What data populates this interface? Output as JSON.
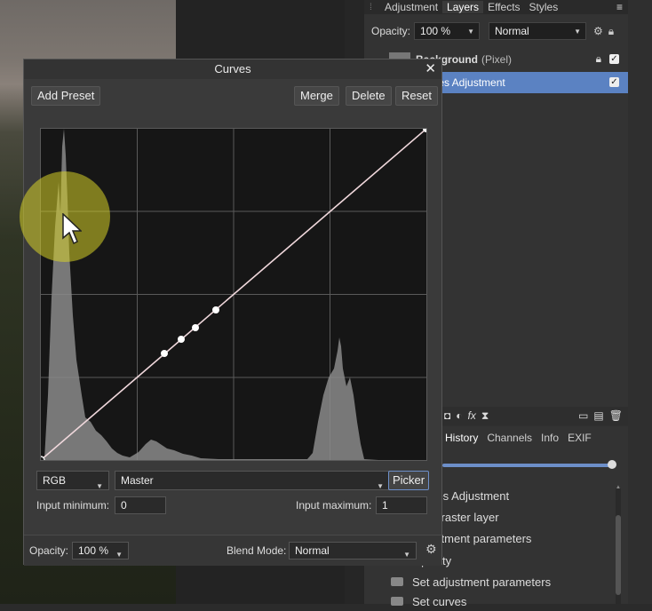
{
  "layers_panel": {
    "tabs": [
      "Adjustment",
      "Layers",
      "Effects",
      "Styles"
    ],
    "active_tab": "Layers",
    "opacity_label": "Opacity:",
    "opacity_value": "100 %",
    "blend_mode": "Normal",
    "layers": [
      {
        "name": "Background",
        "type": "(Pixel)",
        "selected": false
      },
      {
        "name": "Curves Adjustment",
        "selected": true
      }
    ]
  },
  "history_panel": {
    "tabs": [
      "History",
      "Channels",
      "Info",
      "EXIF"
    ],
    "active_tab": "History",
    "items": [
      "Curves Adjustment",
      "Pass raster layer",
      "Adjustment parameters",
      "Opacity",
      "Set adjustment parameters",
      "Set curves"
    ]
  },
  "curves_dialog": {
    "title": "Curves",
    "add_preset_label": "Add Preset",
    "merge_label": "Merge",
    "delete_label": "Delete",
    "reset_label": "Reset",
    "channel_mode": "RGB",
    "channel": "Master",
    "picker_label": "Picker",
    "input_min_label": "Input minimum:",
    "input_min_value": "0",
    "input_max_label": "Input maximum:",
    "input_max_value": "1",
    "opacity_label": "Opacity:",
    "opacity_value": "100 %",
    "blend_mode_label": "Blend Mode:",
    "blend_mode_value": "Normal",
    "curve_points": [
      [
        0,
        0
      ],
      [
        0.32,
        0.32
      ],
      [
        0.365,
        0.365
      ],
      [
        0.4,
        0.4
      ],
      [
        0.455,
        0.455
      ],
      [
        1,
        1
      ]
    ]
  },
  "colors": {
    "accent": "#5b82c2",
    "curve_line": "#f0d8dc",
    "histogram": "#8a8a8a",
    "cursor_highlight": "#d7d228"
  }
}
